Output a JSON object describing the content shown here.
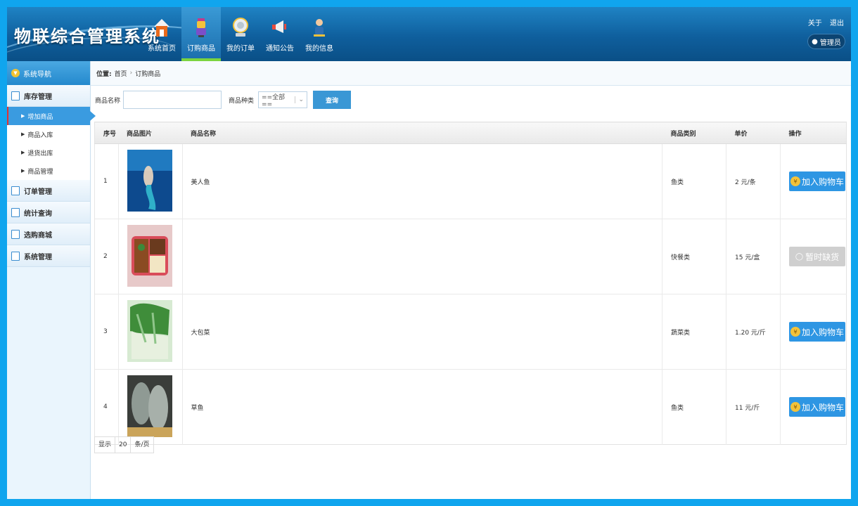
{
  "app": {
    "title": "物联综合管理系统"
  },
  "nav": [
    {
      "label": "系统首页",
      "icon": "house-icon"
    },
    {
      "label": "订购商品",
      "icon": "drink-cup-icon",
      "active": true
    },
    {
      "label": "我的订单",
      "icon": "globe-icon"
    },
    {
      "label": "通知公告",
      "icon": "megaphone-icon"
    },
    {
      "label": "我的信息",
      "icon": "person-icon"
    }
  ],
  "top_links": {
    "about": "关于",
    "logout": "退出"
  },
  "user": {
    "label": "管理员"
  },
  "sidebar": {
    "header": "系统导航",
    "groups": [
      {
        "label": "库存管理",
        "items": [
          {
            "label": "增加商品",
            "active": true
          },
          {
            "label": "商品入库"
          },
          {
            "label": "退货出库"
          },
          {
            "label": "商品管理"
          }
        ]
      },
      {
        "label": "订单管理"
      },
      {
        "label": "统计查询"
      },
      {
        "label": "选购商城"
      },
      {
        "label": "系统管理"
      }
    ]
  },
  "breadcrumb": {
    "prefix": "位置:",
    "home": "首页",
    "current": "订购商品"
  },
  "search": {
    "name_label": "商品名称",
    "name_value": "",
    "category_label": "商品种类",
    "category_selected": "==全部==",
    "query_button": "查询"
  },
  "table": {
    "headers": [
      "序号",
      "商品图片",
      "商品名称",
      "商品类别",
      "单价",
      "操作"
    ],
    "rows": [
      {
        "no": "1",
        "name": "美人鱼",
        "category": "鱼类",
        "price": "2 元/条",
        "action": "加入购物车",
        "status": "available",
        "image": "mermaid-image"
      },
      {
        "no": "2",
        "name": "",
        "category": "快餐类",
        "price": "15 元/盒",
        "action": "暂时缺货",
        "status": "out_of_stock",
        "image": "bento-box-image"
      },
      {
        "no": "3",
        "name": "大包菜",
        "category": "蔬菜类",
        "price": "1.20 元/斤",
        "action": "加入购物车",
        "status": "available",
        "image": "cabbage-image"
      },
      {
        "no": "4",
        "name": "草鱼",
        "category": "鱼类",
        "price": "11 元/斤",
        "action": "加入购物车",
        "status": "available",
        "image": "fish-image"
      }
    ]
  },
  "pager": {
    "show": "显示",
    "per_page": "20",
    "unit": "条/页"
  },
  "colors": {
    "accent": "#2e96e3",
    "header": "#0f5f9d",
    "frame": "#10a5ee",
    "active_nav": "#7bd43f"
  }
}
